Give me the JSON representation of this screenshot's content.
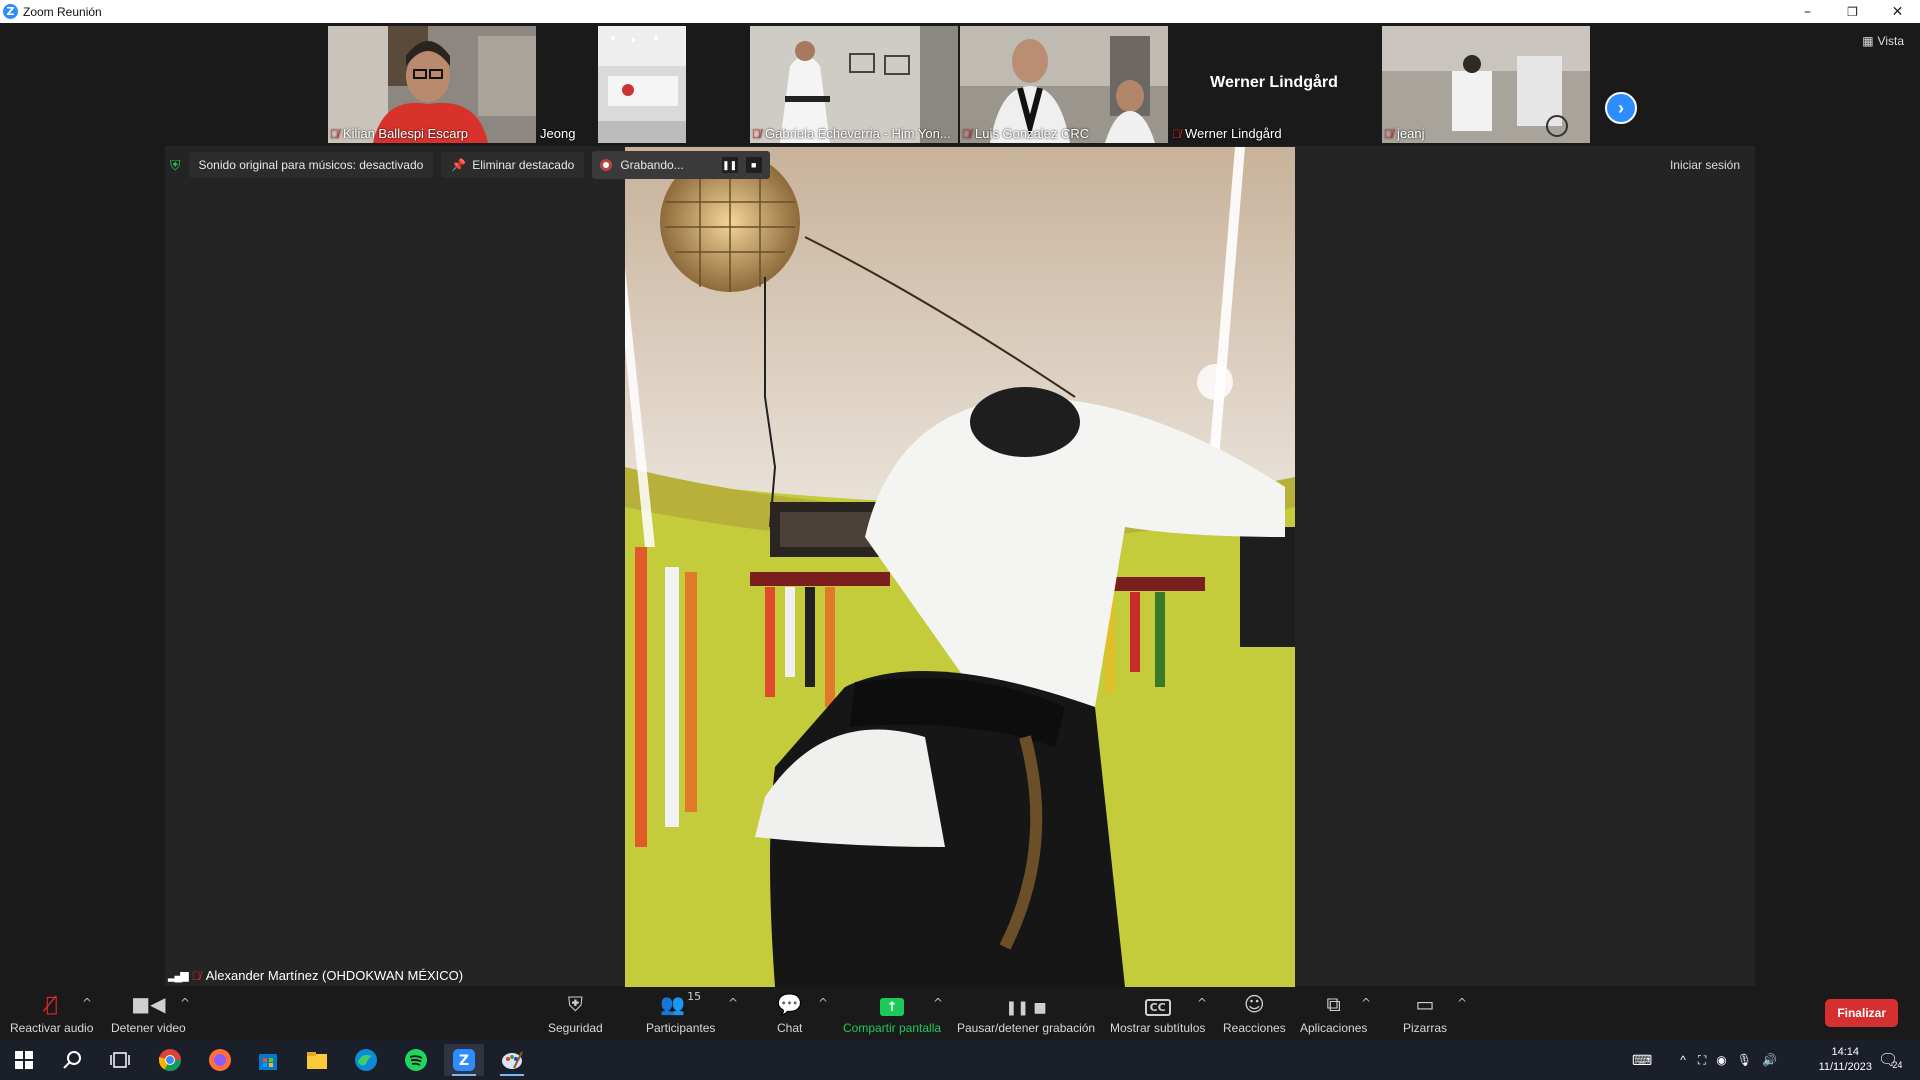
{
  "window": {
    "title": "Zoom Reunión",
    "minimize": "–",
    "restore": "❐",
    "close": "✕"
  },
  "strip": {
    "vista_label": "Vista",
    "next_icon": "›",
    "tiles": [
      {
        "name": "Kilian Ballespi Escarp",
        "muted": true
      },
      {
        "name": "Jeong",
        "muted": false
      },
      {
        "name": "Gabriela Echeverria - Him Yon...",
        "muted": true
      },
      {
        "name": "Luis Gonzalez CRC",
        "muted": true
      },
      {
        "name": "Werner Lindgård",
        "muted": true,
        "big_name": "Werner Lindgård"
      },
      {
        "name": "jeanj",
        "muted": true
      }
    ]
  },
  "infobar": {
    "original_sound": "Sonido original para músicos: desactivado",
    "remove_spotlight": "Eliminar destacado",
    "recording": "Grabando...",
    "pause_icon": "❚❚",
    "stop_icon": "■",
    "login": "Iniciar sesión"
  },
  "speaker": {
    "name": "Alexander Martínez (OHDOKWAN MÉXICO)"
  },
  "toolbar": {
    "unmute": "Reactivar audio",
    "stop_video": "Detener video",
    "security": "Seguridad",
    "participants": "Participantes",
    "participants_count": "15",
    "chat": "Chat",
    "share_screen": "Compartir pantalla",
    "pause_recording": "Pausar/detener grabación",
    "captions": "Mostrar subtítulos",
    "cc": "CC",
    "reactions": "Reacciones",
    "apps": "Aplicaciones",
    "whiteboards": "Pizarras",
    "end": "Finalizar",
    "caret": "^"
  },
  "taskbar": {
    "time": "14:14",
    "date": "11/11/2023",
    "notifications": "24"
  },
  "colors": {
    "zoom_blue": "#2d8cff",
    "share_green": "#1ec95b",
    "end_red": "#d62f2f",
    "mic_off_red": "#e02828"
  }
}
